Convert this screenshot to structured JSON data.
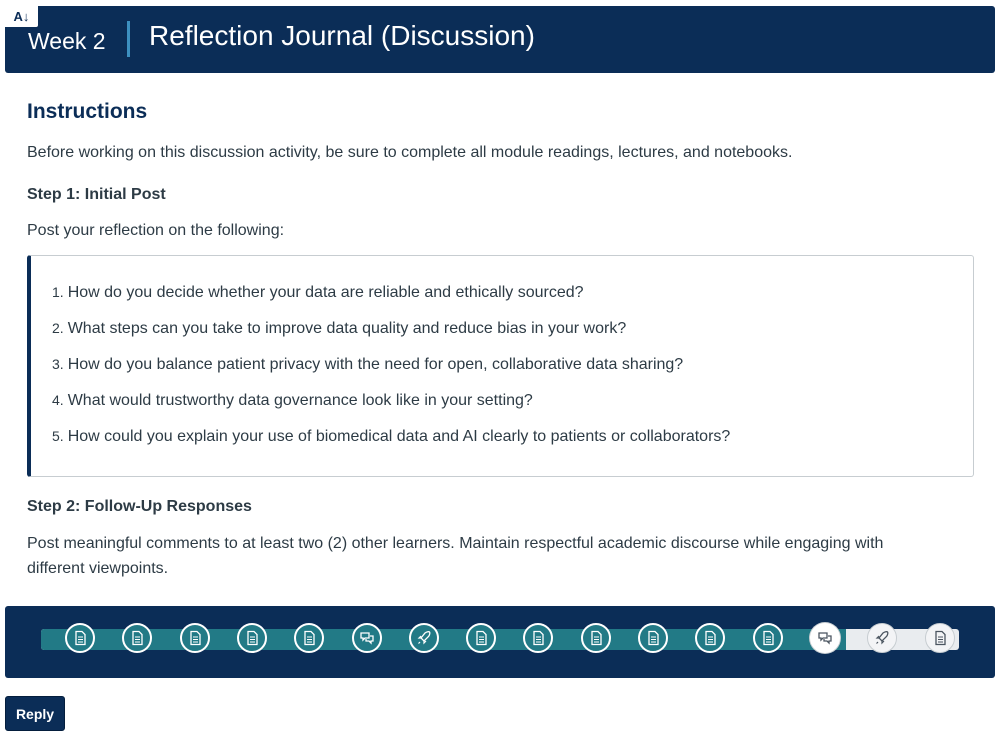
{
  "banner": {
    "a11y_label": "A↓",
    "week": "Week 2",
    "title": "Reflection Journal (Discussion)",
    "bg_color": "#0b2d57"
  },
  "content": {
    "heading": "Instructions",
    "intro": "Before working on this discussion activity, be sure to complete all module readings, lectures, and notebooks.",
    "step1_title": "Step 1: Initial Post",
    "step1_text": "Post your reflection on the following:",
    "questions": [
      {
        "num": "1.",
        "text": "How do you decide whether your data are reliable and ethically sourced?"
      },
      {
        "num": "2.",
        "text": "What steps can you take to improve data quality and reduce bias in your work?"
      },
      {
        "num": "3.",
        "text": "How do you balance patient privacy with the need for open, collaborative data sharing?"
      },
      {
        "num": "4.",
        "text": "What would trustworthy data governance look like in your setting?"
      },
      {
        "num": "5.",
        "text": "How could you explain your use of biomedical data and AI clearly to patients or collaborators?"
      }
    ],
    "step2_title": "Step 2: Follow-Up Responses",
    "step2_text_line1": "Post meaningful comments to at least two (2) other learners. Maintain respectful academic discourse while engaging with",
    "step2_text_line2": "different viewpoints."
  },
  "progress": {
    "accent_color": "#227a86",
    "items": [
      {
        "icon": "page-icon",
        "status": "done"
      },
      {
        "icon": "page-icon",
        "status": "done"
      },
      {
        "icon": "page-icon",
        "status": "done"
      },
      {
        "icon": "page-icon",
        "status": "done"
      },
      {
        "icon": "page-icon",
        "status": "done"
      },
      {
        "icon": "discussion-icon",
        "status": "done"
      },
      {
        "icon": "rocket-icon",
        "status": "done"
      },
      {
        "icon": "page-icon",
        "status": "done"
      },
      {
        "icon": "page-icon",
        "status": "done"
      },
      {
        "icon": "page-icon",
        "status": "done"
      },
      {
        "icon": "page-icon",
        "status": "done"
      },
      {
        "icon": "page-icon",
        "status": "done"
      },
      {
        "icon": "page-icon",
        "status": "done"
      },
      {
        "icon": "discussion-icon",
        "status": "current"
      },
      {
        "icon": "rocket-icon",
        "status": "todo"
      },
      {
        "icon": "page-icon",
        "status": "todo"
      }
    ]
  },
  "actions": {
    "reply_label": "Reply"
  }
}
